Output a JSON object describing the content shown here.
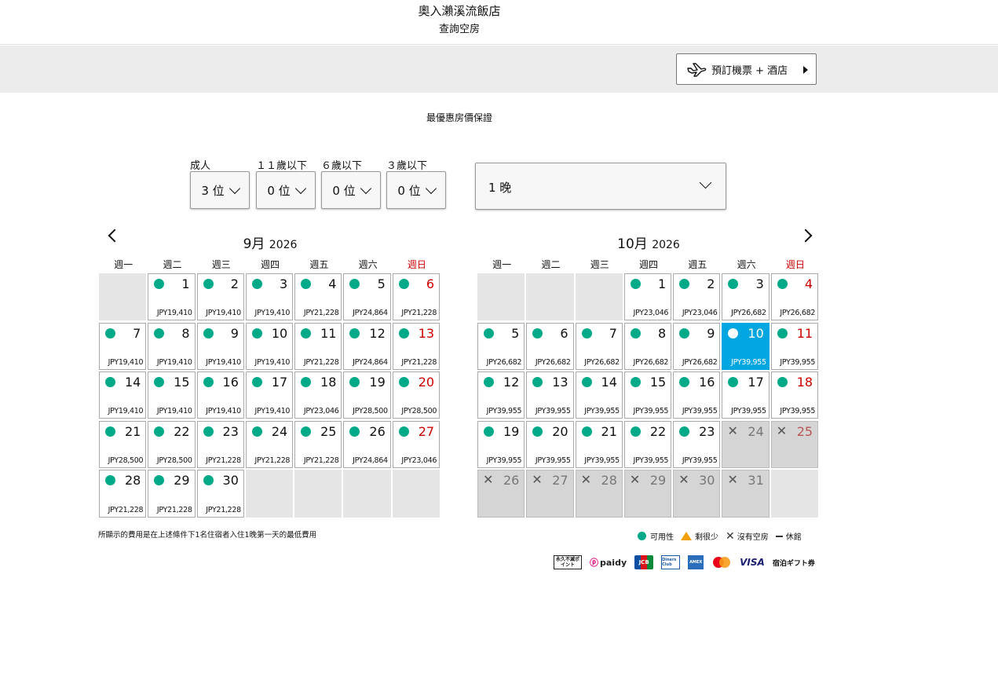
{
  "header": {
    "hotel_name": "奧入瀨溪流飯店",
    "subtitle": "查詢空房"
  },
  "flight_button": {
    "label": "預訂機票 + 酒店"
  },
  "guarantee_text": "最優惠房價保證",
  "guests": [
    {
      "label": "成人",
      "value": "3 位"
    },
    {
      "label": "１１歲以下",
      "value": "0 位"
    },
    {
      "label": "６歲以下",
      "value": "0 位"
    },
    {
      "label": "３歲以下",
      "value": "0 位"
    }
  ],
  "nights": {
    "value": "1 晚"
  },
  "weekdays": [
    "週一",
    "週二",
    "週三",
    "週四",
    "週五",
    "週六",
    "週日"
  ],
  "calendars": [
    {
      "month": "9月",
      "year": "2026",
      "leading_blanks": 1,
      "trailing_blanks": 4,
      "days": [
        {
          "d": "1",
          "price": "JPY19,410",
          "status": "available"
        },
        {
          "d": "2",
          "price": "JPY19,410",
          "status": "available"
        },
        {
          "d": "3",
          "price": "JPY19,410",
          "status": "available"
        },
        {
          "d": "4",
          "price": "JPY21,228",
          "status": "available"
        },
        {
          "d": "5",
          "price": "JPY24,864",
          "status": "available"
        },
        {
          "d": "6",
          "price": "JPY21,228",
          "status": "available"
        },
        {
          "d": "7",
          "price": "JPY19,410",
          "status": "available"
        },
        {
          "d": "8",
          "price": "JPY19,410",
          "status": "available"
        },
        {
          "d": "9",
          "price": "JPY19,410",
          "status": "available"
        },
        {
          "d": "10",
          "price": "JPY19,410",
          "status": "available"
        },
        {
          "d": "11",
          "price": "JPY21,228",
          "status": "available"
        },
        {
          "d": "12",
          "price": "JPY24,864",
          "status": "available"
        },
        {
          "d": "13",
          "price": "JPY21,228",
          "status": "available"
        },
        {
          "d": "14",
          "price": "JPY19,410",
          "status": "available"
        },
        {
          "d": "15",
          "price": "JPY19,410",
          "status": "available"
        },
        {
          "d": "16",
          "price": "JPY19,410",
          "status": "available"
        },
        {
          "d": "17",
          "price": "JPY19,410",
          "status": "available"
        },
        {
          "d": "18",
          "price": "JPY23,046",
          "status": "available"
        },
        {
          "d": "19",
          "price": "JPY28,500",
          "status": "available"
        },
        {
          "d": "20",
          "price": "JPY28,500",
          "status": "available"
        },
        {
          "d": "21",
          "price": "JPY28,500",
          "status": "available"
        },
        {
          "d": "22",
          "price": "JPY28,500",
          "status": "available"
        },
        {
          "d": "23",
          "price": "JPY21,228",
          "status": "available"
        },
        {
          "d": "24",
          "price": "JPY21,228",
          "status": "available"
        },
        {
          "d": "25",
          "price": "JPY21,228",
          "status": "available"
        },
        {
          "d": "26",
          "price": "JPY24,864",
          "status": "available"
        },
        {
          "d": "27",
          "price": "JPY23,046",
          "status": "available"
        },
        {
          "d": "28",
          "price": "JPY21,228",
          "status": "available"
        },
        {
          "d": "29",
          "price": "JPY21,228",
          "status": "available"
        },
        {
          "d": "30",
          "price": "JPY21,228",
          "status": "available"
        }
      ]
    },
    {
      "month": "10月",
      "year": "2026",
      "leading_blanks": 3,
      "trailing_blanks": 1,
      "days": [
        {
          "d": "1",
          "price": "JPY23,046",
          "status": "available"
        },
        {
          "d": "2",
          "price": "JPY23,046",
          "status": "available"
        },
        {
          "d": "3",
          "price": "JPY26,682",
          "status": "available"
        },
        {
          "d": "4",
          "price": "JPY26,682",
          "status": "available"
        },
        {
          "d": "5",
          "price": "JPY26,682",
          "status": "available"
        },
        {
          "d": "6",
          "price": "JPY26,682",
          "status": "available"
        },
        {
          "d": "7",
          "price": "JPY26,682",
          "status": "available"
        },
        {
          "d": "8",
          "price": "JPY26,682",
          "status": "available"
        },
        {
          "d": "9",
          "price": "JPY26,682",
          "status": "available"
        },
        {
          "d": "10",
          "price": "JPY39,955",
          "status": "selected"
        },
        {
          "d": "11",
          "price": "JPY39,955",
          "status": "available"
        },
        {
          "d": "12",
          "price": "JPY39,955",
          "status": "available"
        },
        {
          "d": "13",
          "price": "JPY39,955",
          "status": "available"
        },
        {
          "d": "14",
          "price": "JPY39,955",
          "status": "available"
        },
        {
          "d": "15",
          "price": "JPY39,955",
          "status": "available"
        },
        {
          "d": "16",
          "price": "JPY39,955",
          "status": "available"
        },
        {
          "d": "17",
          "price": "JPY39,955",
          "status": "available"
        },
        {
          "d": "18",
          "price": "JPY39,955",
          "status": "available"
        },
        {
          "d": "19",
          "price": "JPY39,955",
          "status": "available"
        },
        {
          "d": "20",
          "price": "JPY39,955",
          "status": "available"
        },
        {
          "d": "21",
          "price": "JPY39,955",
          "status": "available"
        },
        {
          "d": "22",
          "price": "JPY39,955",
          "status": "available"
        },
        {
          "d": "23",
          "price": "JPY39,955",
          "status": "available"
        },
        {
          "d": "24",
          "price": "",
          "status": "full"
        },
        {
          "d": "25",
          "price": "",
          "status": "full"
        },
        {
          "d": "26",
          "price": "",
          "status": "full"
        },
        {
          "d": "27",
          "price": "",
          "status": "full"
        },
        {
          "d": "28",
          "price": "",
          "status": "full"
        },
        {
          "d": "29",
          "price": "",
          "status": "full"
        },
        {
          "d": "30",
          "price": "",
          "status": "full"
        },
        {
          "d": "31",
          "price": "",
          "status": "full"
        }
      ]
    }
  ],
  "footnote": "所顯示的費用是在上述條件下1名住宿者入住1晚第一天的最低費用",
  "legend": {
    "available": "可用性",
    "few_left": "剩很少",
    "full": "沒有空房",
    "closed": "休館"
  },
  "payments": {
    "eikyu_points": "永久不滅ポイント",
    "paidy": "paidy",
    "jcb": "JCB",
    "diners": "Diners Club",
    "amex": "AMEX",
    "visa": "VISA",
    "gift_card": "宿泊ギフト券"
  },
  "colors": {
    "available": "#00a988",
    "selected": "#00a6e0",
    "sunday": "#cc0000",
    "few_left": "#f0a000"
  }
}
